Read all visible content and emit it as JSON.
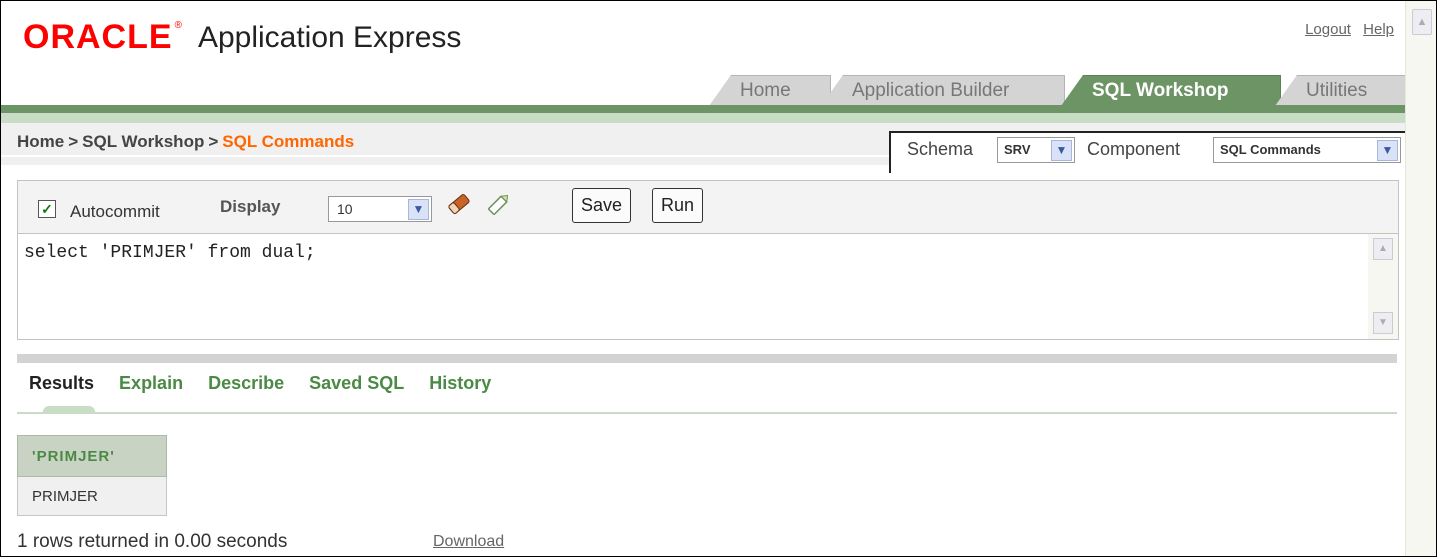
{
  "header": {
    "brand": "ORACLE",
    "registered": "®",
    "product": "Application Express",
    "links": [
      "Logout",
      "Help"
    ]
  },
  "tabs": [
    {
      "label": "Home",
      "active": false
    },
    {
      "label": "Application Builder",
      "active": false
    },
    {
      "label": "SQL Workshop",
      "active": true
    },
    {
      "label": "Utilities",
      "active": false
    }
  ],
  "breadcrumb": {
    "items": [
      "Home",
      "SQL Workshop"
    ],
    "separator": ">",
    "current": "SQL Commands"
  },
  "schema": {
    "schema_label": "Schema",
    "schema_value": "SRV",
    "component_label": "Component",
    "component_value": "SQL Commands"
  },
  "toolbar": {
    "autocommit_label": "Autocommit",
    "autocommit_checked": true,
    "display_label": "Display",
    "display_value": "10",
    "save_label": "Save",
    "run_label": "Run"
  },
  "editor": {
    "sql": "select 'PRIMJER' from dual;"
  },
  "result_tabs": [
    "Results",
    "Explain",
    "Describe",
    "Saved SQL",
    "History"
  ],
  "result_tabs_active": "Results",
  "results": {
    "columns": [
      "'PRIMJER'"
    ],
    "rows": [
      [
        "PRIMJER"
      ]
    ]
  },
  "status": {
    "text": "1 rows returned in 0.00 seconds",
    "download_label": "Download"
  },
  "colors": {
    "brand_red": "#ff0000",
    "accent_green": "#6c9464",
    "link_green": "#4b8a45",
    "breadcrumb_current": "#ff6600"
  }
}
